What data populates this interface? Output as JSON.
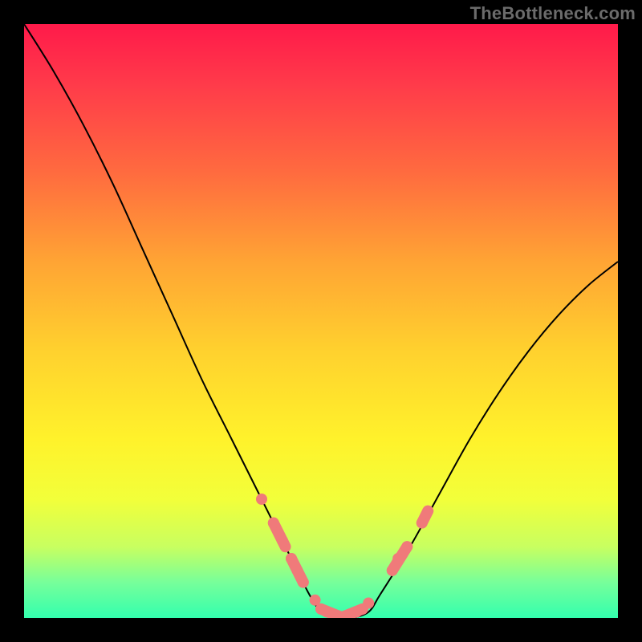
{
  "watermark": "TheBottleneck.com",
  "chart_data": {
    "type": "line",
    "title": "",
    "xlabel": "",
    "ylabel": "",
    "xlim": [
      0,
      100
    ],
    "ylim": [
      0,
      100
    ],
    "series": [
      {
        "name": "bottleneck-curve",
        "x": [
          0,
          5,
          10,
          15,
          20,
          25,
          30,
          35,
          40,
          45,
          48,
          50,
          52,
          55,
          58,
          60,
          65,
          70,
          75,
          80,
          85,
          90,
          95,
          100
        ],
        "y": [
          100,
          92,
          83,
          73,
          62,
          51,
          40,
          30,
          20,
          10,
          4,
          1,
          0,
          0,
          1,
          4,
          12,
          21,
          30,
          38,
          45,
          51,
          56,
          60
        ]
      }
    ],
    "markers": {
      "name": "highlighted-points",
      "points": [
        {
          "x": 40,
          "y": 20
        },
        {
          "x": 42,
          "y": 16
        },
        {
          "x": 43.5,
          "y": 13
        },
        {
          "x": 45,
          "y": 10
        },
        {
          "x": 46,
          "y": 8
        },
        {
          "x": 47,
          "y": 6
        },
        {
          "x": 49,
          "y": 3
        },
        {
          "x": 50,
          "y": 1.5
        },
        {
          "x": 51,
          "y": 1
        },
        {
          "x": 52,
          "y": 0.5
        },
        {
          "x": 53,
          "y": 0.3
        },
        {
          "x": 54,
          "y": 0.3
        },
        {
          "x": 55,
          "y": 0.5
        },
        {
          "x": 56,
          "y": 1
        },
        {
          "x": 57,
          "y": 1.5
        },
        {
          "x": 58,
          "y": 2.5
        },
        {
          "x": 62,
          "y": 8
        },
        {
          "x": 63,
          "y": 10
        },
        {
          "x": 64.5,
          "y": 12
        },
        {
          "x": 67,
          "y": 16
        },
        {
          "x": 68,
          "y": 18
        }
      ],
      "pills": [
        {
          "x1": 42,
          "y1": 16,
          "x2": 44,
          "y2": 12
        },
        {
          "x1": 45,
          "y1": 10,
          "x2": 47,
          "y2": 6
        },
        {
          "x1": 50,
          "y1": 1.5,
          "x2": 53,
          "y2": 0.3
        },
        {
          "x1": 54,
          "y1": 0.3,
          "x2": 57,
          "y2": 1.5
        },
        {
          "x1": 62,
          "y1": 8,
          "x2": 64.5,
          "y2": 12
        },
        {
          "x1": 67,
          "y1": 16,
          "x2": 68,
          "y2": 18
        }
      ]
    },
    "background": {
      "type": "vertical-gradient",
      "stops": [
        {
          "pos": 0,
          "color": "#ff1a4a"
        },
        {
          "pos": 55,
          "color": "#ffd12e"
        },
        {
          "pos": 100,
          "color": "#33ffae"
        }
      ]
    }
  }
}
